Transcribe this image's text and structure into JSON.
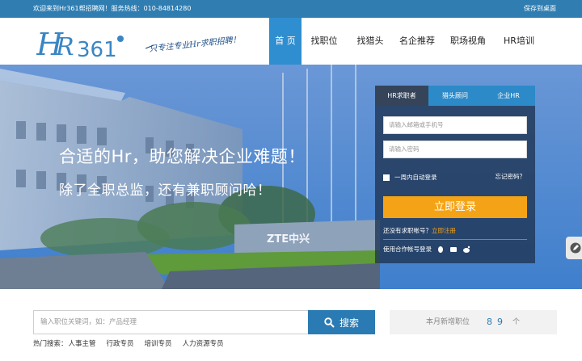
{
  "topbar": {
    "welcome": "欢迎来到Hr361帮招聘网！服务热线：010-84814280",
    "save_desktop": "保存到桌面"
  },
  "header": {
    "logo_text": "HR361",
    "slogan": "只专注专业Hr求职招聘！",
    "nav": [
      {
        "label": "首 页",
        "active": true
      },
      {
        "label": "找职位",
        "active": false
      },
      {
        "label": "找猎头",
        "active": false
      },
      {
        "label": "名企推荐",
        "active": false
      },
      {
        "label": "职场视角",
        "active": false
      },
      {
        "label": "HR培训",
        "active": false
      }
    ]
  },
  "banner": {
    "headline": "合适的Hr，助您解决企业难题！",
    "subline": "除了全职总监，还有兼职顾问哈！",
    "sign_text": "ZTE中兴"
  },
  "login": {
    "tabs": [
      {
        "label": "HR求职者",
        "active": true
      },
      {
        "label": "猎头顾问",
        "active": false
      },
      {
        "label": "企业HR",
        "active": false
      }
    ],
    "username_placeholder": "请输入邮箱或手机号",
    "password_placeholder": "请输入密码",
    "remember_label": "一周内自动登录",
    "forgot_label": "忘记密码？",
    "login_button": "立即登录",
    "no_account": "还没有求职帐号？",
    "register_link": "立即注册",
    "partner_label": "使用合作帐号登录",
    "partner_icons": [
      "qq-icon",
      "taobao-icon",
      "weibo-icon"
    ]
  },
  "search": {
    "placeholder": "输入职位关键词，如：产品经理",
    "button": "搜索",
    "hot_label": "热门搜索：",
    "hot_items": [
      "人事主管",
      "行政专员",
      "培训专员",
      "人力资源专员"
    ]
  },
  "stats": {
    "label": "本月新增职位",
    "count": "89",
    "unit": "个"
  },
  "colors": {
    "topbar": "#2f7db1",
    "nav_active": "#2f8ed0",
    "login_button": "#f5a316",
    "search_button": "#2a7bb4"
  }
}
